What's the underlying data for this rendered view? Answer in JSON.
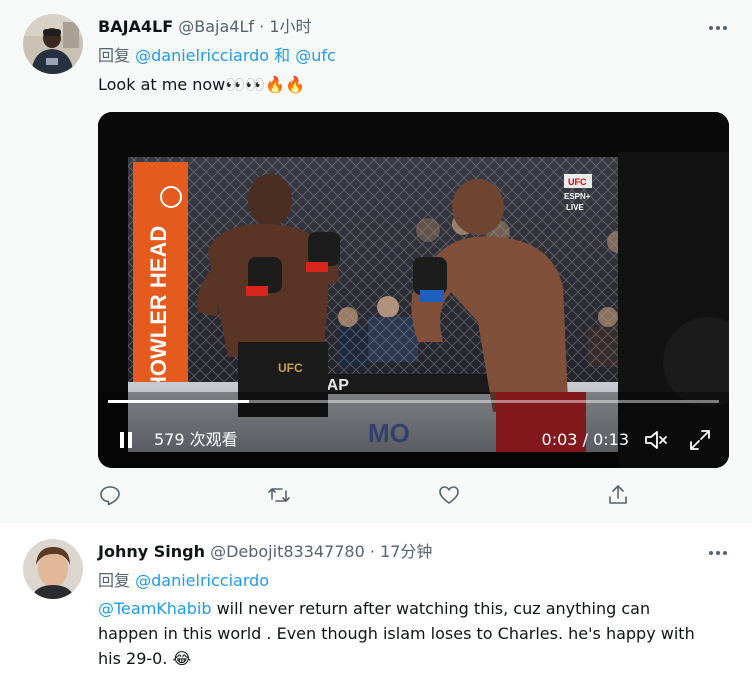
{
  "tweet1": {
    "name": "BAJA4LF",
    "handle": "@Baja4Lf",
    "time": "1小时",
    "reply_prefix": "回复",
    "reply_to_1": "@danielricciardo",
    "reply_and": "和",
    "reply_to_2": "@ufc",
    "text": "Look at me now👀👀🔥🔥",
    "video": {
      "sponsor_text": "HOWLER HEAD",
      "banner_text": "MANSCAP",
      "canvas_text": "MO",
      "broadcaster": "ESPN+",
      "live_label": "LIVE",
      "ufc_badge": "UFC",
      "fighter_shorts_text": "UFC",
      "views": "579 次观看",
      "time_current": "0:03",
      "time_sep": "/",
      "time_total": "0:13",
      "progress": 0.23
    }
  },
  "tweet2": {
    "name": "Johny Singh",
    "handle": "@Debojit83347780",
    "time": "17分钟",
    "reply_prefix": "回复",
    "reply_to_1": "@danielricciardo",
    "mention": "@TeamKhabib",
    "text_line1_rest": " will never return after watching this, cuz anything can",
    "text_line2": "happen in this world . Even though islam loses to Charles. he's happy with",
    "text_line3": "his 29-0. 😂"
  },
  "separator_dot": "·",
  "colors": {
    "link": "#1d9bf0",
    "secondary_text": "#536471",
    "hover_bg": "#f7f9f9",
    "sponsor_orange": "#e55a1d",
    "fighter_gloves_red": "#d9261c",
    "fighter_gloves_blue": "#1e5fbf",
    "fighter_shorts_red": "#c8262c"
  }
}
